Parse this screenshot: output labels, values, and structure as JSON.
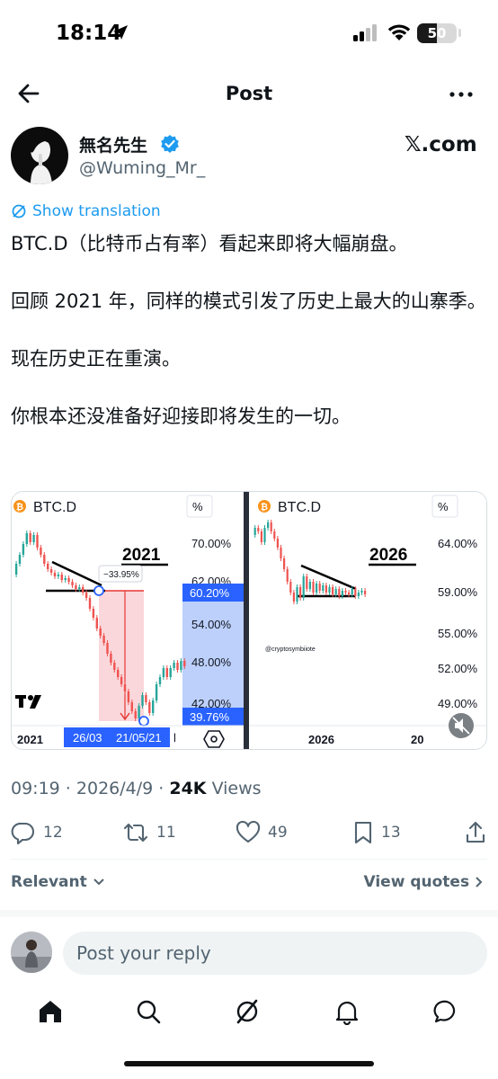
{
  "status_bar": {
    "time": "18:14",
    "battery": "50",
    "battery_level": 0.5
  },
  "header": {
    "title": "Post"
  },
  "author": {
    "name": "無名先生",
    "handle": "@Wuming_Mr_",
    "source": "𝕏.com"
  },
  "translate_label": "Show translation",
  "tweet": {
    "paragraphs": [
      "BTC.D（比特币占有率）看起来即将大幅崩盘。",
      "回顾 2021 年，同样的模式引发了历史上最大的山寨季。",
      "现在历史正在重演。",
      "你根本还没准备好迎接即将发生的一切。"
    ]
  },
  "media": {
    "left": {
      "symbol": "BTC.D",
      "unit": "%",
      "year_label": "2021",
      "pct_change": "−33.95%",
      "price_ticks": [
        "70.00%",
        "62.00%",
        "54.00%",
        "48.00%",
        "42.00%"
      ],
      "price_high": "60.20%",
      "price_low": "39.76%",
      "date_start": "26/03",
      "date_end": "21/05/21",
      "x_label": "2021",
      "x_label_tail": "l",
      "logo": "TV"
    },
    "right": {
      "symbol": "BTC.D",
      "unit": "%",
      "year_label": "2026",
      "price_ticks": [
        "64.00%",
        "59.00%",
        "55.00%",
        "52.00%",
        "49.00%"
      ],
      "watermark": "@cryptosymbiiote",
      "x_label": "2026",
      "x_label_tail": "20"
    }
  },
  "meta": {
    "time": "09:19",
    "date": "2026/4/9",
    "views_count": "24K",
    "views_label": "Views"
  },
  "actions": {
    "replies": "12",
    "reposts": "11",
    "likes": "49",
    "bookmarks": "13"
  },
  "sort": {
    "relevant": "Relevant",
    "view_quotes": "View quotes"
  },
  "reply": {
    "placeholder": "Post your reply"
  },
  "colors": {
    "accent": "#1d9bf0",
    "candle_up": "#26a69a",
    "candle_down": "#ef5350",
    "tv_blue": "#2962ff"
  }
}
